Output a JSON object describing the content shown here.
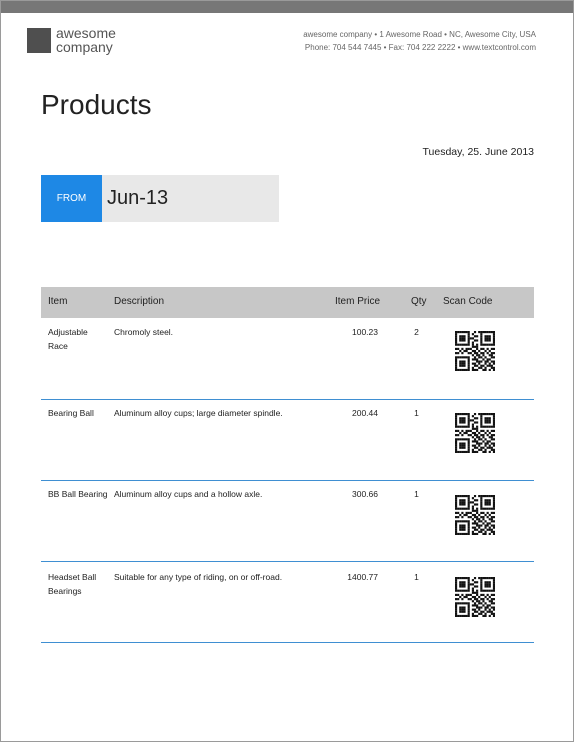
{
  "header": {
    "logo_text_line1": "awesome",
    "logo_text_line2": "company",
    "company_line1": "awesome company • 1 Awesome Road • NC, Awesome City, USA",
    "company_line2": "Phone: 704 544 7445 • Fax: 704 222 2222 • www.textcontrol.com"
  },
  "title": "Products",
  "date": "Tuesday, 25. June 2013",
  "from": {
    "label": "FROM",
    "value": "Jun-13"
  },
  "table": {
    "headers": {
      "item": "Item",
      "description": "Description",
      "price": "Item Price",
      "qty": "Qty",
      "scan": "Scan Code"
    },
    "rows": [
      {
        "item": "Adjustable Race",
        "description": "Chromoly steel.",
        "price": "100.23",
        "qty": "2",
        "scan_icon": "qr-code-icon"
      },
      {
        "item": "Bearing Ball",
        "description": "Aluminum alloy cups; large diameter spindle.",
        "price": "200.44",
        "qty": "1",
        "scan_icon": "qr-code-icon"
      },
      {
        "item": "BB Ball Bearing",
        "description": "Aluminum alloy cups and a hollow axle.",
        "price": "300.66",
        "qty": "1",
        "scan_icon": "qr-code-icon"
      },
      {
        "item": "Headset Ball Bearings",
        "description": "Suitable for any type of riding, on or off-road.",
        "price": "1400.77",
        "qty": "1",
        "scan_icon": "qr-code-icon"
      }
    ]
  },
  "colors": {
    "accent": "#1e88e5",
    "rule": "#3f8fd2",
    "header_bg": "#c7c7c7",
    "top_bar": "#777777"
  }
}
